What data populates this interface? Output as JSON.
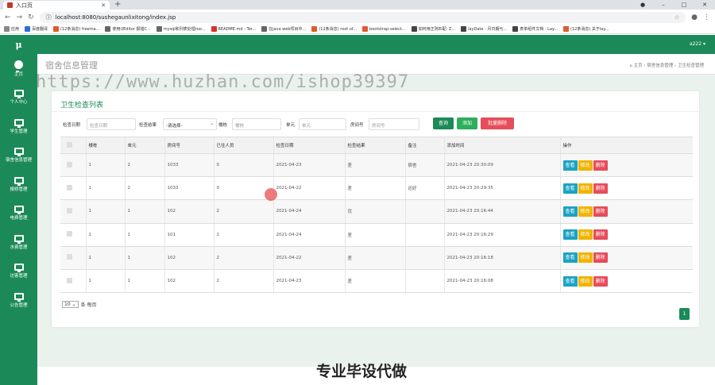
{
  "browser": {
    "tab_title": "入口页",
    "url": "localhost:8080/sushegaunlixitong/index.jsp",
    "bookmarks": [
      "应用",
      "百度翻译",
      "(12条消息) freema...",
      "使用UEditor 报错C...",
      "mysql和列表处理roo...",
      "README.md - Ter...",
      "在java web项目中...",
      "(12条消息) root of...",
      "bootstrap-select...",
      "如何用正则匹配: Z...",
      "layDate - 月日期与...",
      "表单组件文档 - Lay...",
      "(12条消息) 关于lay..."
    ]
  },
  "app": {
    "logo": "μ",
    "user": "a222 ▾",
    "sidebar": [
      "主页",
      "个人中心",
      "学生管理",
      "宿舍信息管理",
      "报修管理",
      "电费管理",
      "水费管理",
      "访客管理",
      "公告管理"
    ],
    "page_title": "宿舍信息管理",
    "breadcrumb": "⌂ 主页  ›  宿舍信息管理  ›  卫生检查管理",
    "watermark": "https://www.huzhan.com/ishop39397",
    "card_title": "卫生检查列表",
    "search": {
      "date_label": "检查日期",
      "date_placeholder": "检查日期",
      "result_label": "检查结果",
      "result_select": "-请选择-",
      "building_label": "楼栋",
      "building_placeholder": "楼栋",
      "unit_label": "单元",
      "unit_placeholder": "单元",
      "room_label": "房间号",
      "room_placeholder": "房间号",
      "query": "查询",
      "add": "添加",
      "batch_delete": "批量删除"
    },
    "table": {
      "headers": [
        "",
        "楼栋",
        "单元",
        "房间号",
        "已住人员",
        "检查日期",
        "检查结果",
        "备注",
        "添加时间",
        "操作"
      ],
      "rows": [
        [
          "1",
          "2",
          "1033",
          "0",
          "2021-04-23",
          "差",
          "宿舍",
          "2021-04-23 20:30:09"
        ],
        [
          "1",
          "2",
          "1033",
          "0",
          "2021-04-22",
          "差",
          "还好",
          "2021-04-23 20:29:35"
        ],
        [
          "1",
          "1",
          "102",
          "2",
          "2021-04-24",
          "优",
          "",
          "2021-04-23 20:16:44"
        ],
        [
          "1",
          "1",
          "101",
          "1",
          "2021-04-24",
          "差",
          "",
          "2021-04-23 20:16:29"
        ],
        [
          "1",
          "1",
          "102",
          "2",
          "2021-04-22",
          "差",
          "",
          "2021-04-23 20:16:18"
        ],
        [
          "1",
          "1",
          "102",
          "2",
          "2021-04-23",
          "差",
          "",
          "2021-04-23 20:16:08"
        ]
      ],
      "actions": [
        "查看",
        "修改",
        "删除"
      ]
    },
    "page_size": "10",
    "page_size_suffix": "条 每页",
    "page": "1",
    "footer_text": "专业毕设代做"
  },
  "colors": {
    "brand": "#1c8a58",
    "view": "#1aa3c3",
    "edit": "#f0b400",
    "delete": "#e74c5a"
  }
}
